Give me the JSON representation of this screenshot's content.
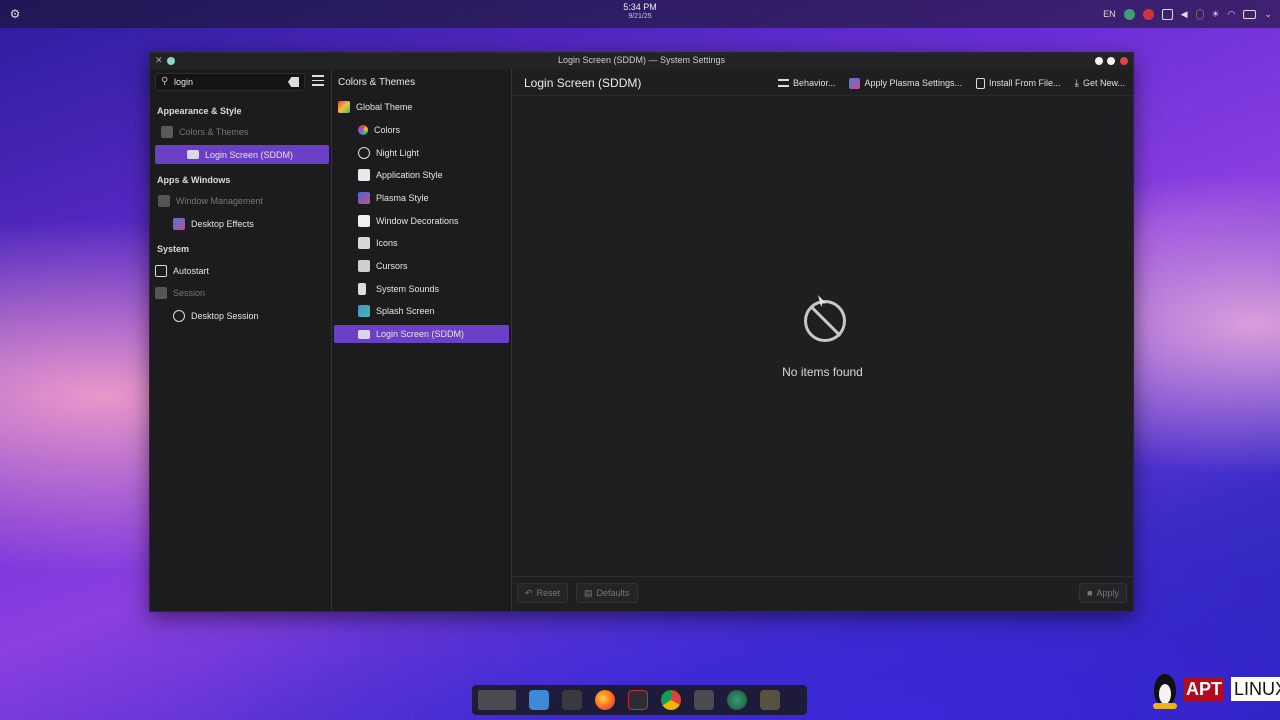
{
  "top_panel": {
    "time": "5:34 PM",
    "date": "9/21/25",
    "keyboard_layout": "EN"
  },
  "window": {
    "title": "Login Screen (SDDM) — System Settings"
  },
  "sidebar": {
    "search_value": "login",
    "categories": [
      {
        "label": "Appearance & Style"
      },
      {
        "label": "Apps & Windows"
      },
      {
        "label": "System"
      }
    ],
    "items": [
      {
        "label": "Colors & Themes"
      },
      {
        "label": "Login Screen (SDDM)"
      },
      {
        "label": "Window Management"
      },
      {
        "label": "Desktop Effects"
      },
      {
        "label": "Autostart"
      },
      {
        "label": "Session"
      },
      {
        "label": "Desktop Session"
      }
    ]
  },
  "middle": {
    "header": "Colors & Themes",
    "items": [
      {
        "label": "Global Theme"
      },
      {
        "label": "Colors"
      },
      {
        "label": "Night Light"
      },
      {
        "label": "Application Style"
      },
      {
        "label": "Plasma Style"
      },
      {
        "label": "Window Decorations"
      },
      {
        "label": "Icons"
      },
      {
        "label": "Cursors"
      },
      {
        "label": "System Sounds"
      },
      {
        "label": "Splash Screen"
      },
      {
        "label": "Login Screen (SDDM)"
      }
    ]
  },
  "main": {
    "title": "Login Screen (SDDM)",
    "toolbar": {
      "behavior": "Behavior...",
      "apply_plasma": "Apply Plasma Settings...",
      "install": "Install From File...",
      "get_new": "Get New..."
    },
    "empty_text": "No items found",
    "footer": {
      "reset": "Reset",
      "defaults": "Defaults",
      "apply": "Apply"
    }
  },
  "watermark": {
    "apt": "APT",
    "linux": "LINUX"
  },
  "colors": {
    "accent": "#6b3fc6",
    "close": "#e0444a"
  }
}
